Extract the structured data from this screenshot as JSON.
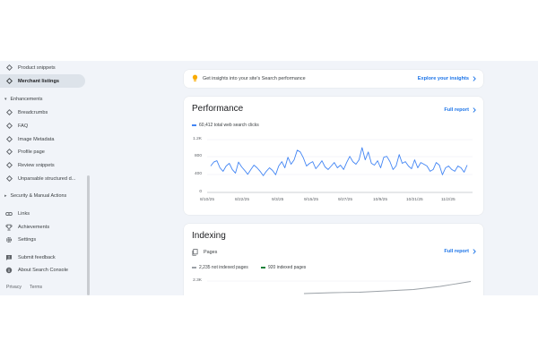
{
  "sidebar": {
    "items": [
      {
        "label": "Product snippets",
        "icon": "diamond-icon"
      },
      {
        "label": "Merchant listings",
        "icon": "diamond-icon",
        "active": true
      },
      {
        "label": "Enhancements",
        "section": true
      },
      {
        "label": "Breadcrumbs",
        "icon": "diamond-icon"
      },
      {
        "label": "FAQ",
        "icon": "diamond-icon"
      },
      {
        "label": "Image Metadata",
        "icon": "diamond-icon"
      },
      {
        "label": "Profile page",
        "icon": "diamond-icon"
      },
      {
        "label": "Review snippets",
        "icon": "diamond-icon"
      },
      {
        "label": "Unparsable structured d...",
        "icon": "diamond-icon"
      },
      {
        "label": "Security & Manual Actions",
        "section": true
      },
      {
        "label": "Links",
        "icon": "link-icon"
      },
      {
        "label": "Achievements",
        "icon": "trophy-icon"
      },
      {
        "label": "Settings",
        "icon": "gear-icon"
      },
      {
        "label": "Submit feedback",
        "icon": "feedback-icon"
      },
      {
        "label": "About Search Console",
        "icon": "info-icon"
      }
    ],
    "footer": {
      "privacy": "Privacy",
      "terms": "Terms"
    }
  },
  "insights": {
    "text": "Get insights into your site's Search performance",
    "link": "Explore your insights"
  },
  "performance": {
    "title": "Performance",
    "full_report": "Full report",
    "metric_label": "60,412 total web search clicks",
    "color": "#4285f4"
  },
  "chart_data": {
    "type": "line",
    "series": [
      {
        "name": "60,412 total web search clicks",
        "values": [
          600,
          690,
          720,
          560,
          480,
          600,
          660,
          520,
          440,
          690,
          580,
          500,
          410,
          520,
          620,
          560,
          480,
          380,
          480,
          560,
          500,
          400,
          600,
          700,
          560,
          800,
          640,
          740,
          960,
          920,
          780,
          600,
          660,
          700,
          540,
          620,
          720,
          580,
          520,
          600,
          680,
          560,
          620,
          520,
          680,
          820,
          700,
          640,
          740,
          1020,
          740,
          920,
          660,
          620,
          720,
          560,
          800,
          820,
          700,
          520,
          600,
          860,
          660,
          700,
          600,
          540,
          740,
          560,
          680,
          640,
          600,
          480,
          520,
          680,
          620,
          400,
          560,
          600,
          520,
          480,
          600,
          560,
          460,
          620
        ]
      }
    ],
    "x_tick_labels": [
      "8/10/25",
      "8/22/25",
      "9/3/25",
      "9/15/25",
      "9/27/25",
      "10/9/25",
      "10/21/25",
      "11/2/25"
    ],
    "y_tick_labels": [
      "1.2K",
      "800",
      "400",
      "0"
    ],
    "ylim": [
      0,
      1200
    ]
  },
  "indexing": {
    "title": "Indexing",
    "pages_label": "Pages",
    "full_report": "Full report",
    "not_indexed": "2,235 not indexed pages",
    "indexed": "920 indexed pages",
    "y_top_label": "2.3K",
    "not_indexed_color": "#9aa0a6",
    "indexed_color": "#188038"
  }
}
